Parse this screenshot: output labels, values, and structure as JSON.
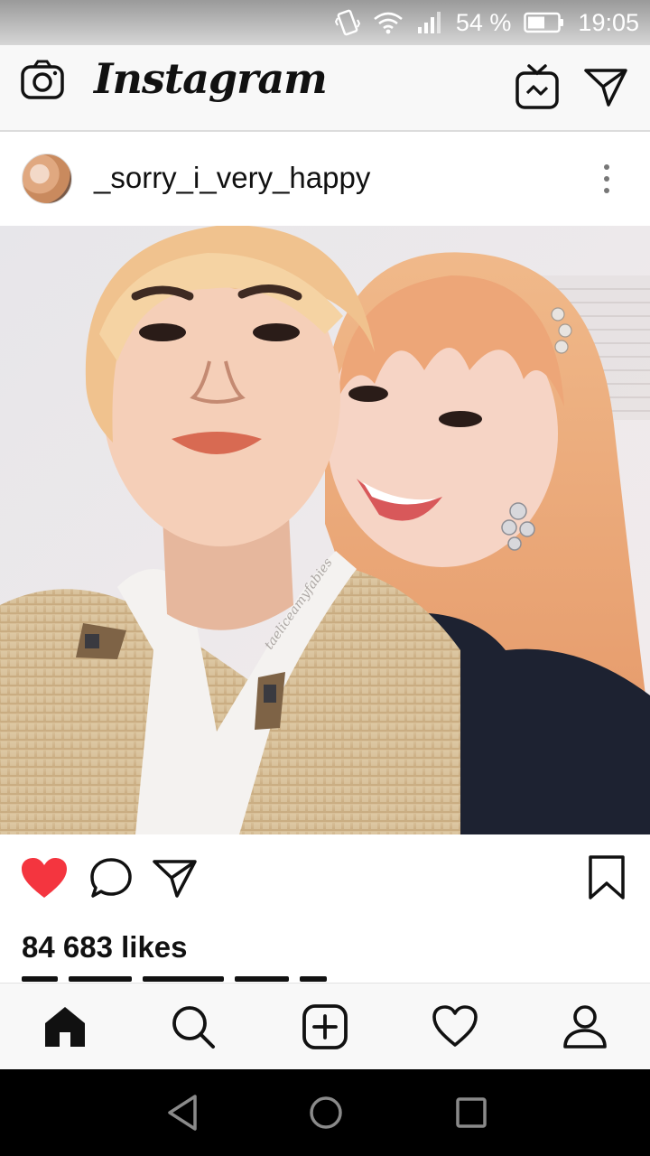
{
  "status_bar": {
    "battery_percent": "54 %",
    "time": "19:05",
    "icons": [
      "vibrate-icon",
      "wifi-icon",
      "signal-icon",
      "battery-icon"
    ]
  },
  "header": {
    "logo_text": "Instagram",
    "icons": [
      "camera-icon",
      "igtv-icon",
      "direct-message-icon"
    ]
  },
  "post": {
    "username": "_sorry_i_very_happy",
    "likes": "84 683 likes",
    "photo_watermark": "taeliceamyfabies",
    "liked": true,
    "heart_color": "#f4353f"
  },
  "bottom_nav": {
    "items": [
      "home-icon",
      "search-icon",
      "new-post-icon",
      "activity-icon",
      "profile-icon"
    ],
    "active": "home-icon"
  },
  "android_nav": {
    "items": [
      "back-icon",
      "home-circle-icon",
      "recents-icon"
    ]
  }
}
